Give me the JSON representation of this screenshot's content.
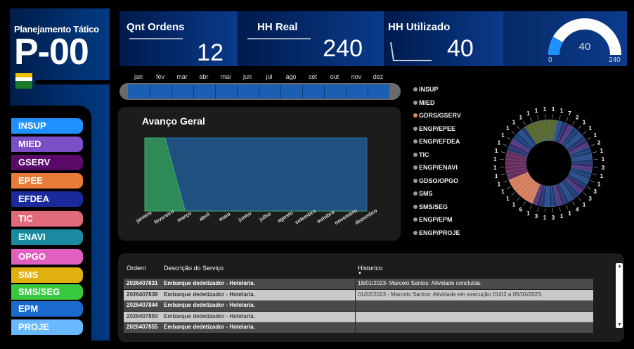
{
  "header": {
    "app_title": "Planejamento Tático",
    "page_code": "P-00"
  },
  "nav": {
    "items": [
      {
        "label": "INSUP",
        "color": "#1e90ff"
      },
      {
        "label": "MIED",
        "color": "#7b4fc8"
      },
      {
        "label": "GSERV",
        "color": "#5b0a6a"
      },
      {
        "label": "EPEE",
        "color": "#e87a3a"
      },
      {
        "label": "EFDEA",
        "color": "#1a2a9a"
      },
      {
        "label": "TIC",
        "color": "#e06a78"
      },
      {
        "label": "ENAVI",
        "color": "#1a8aa0"
      },
      {
        "label": "OPGO",
        "color": "#e060c0"
      },
      {
        "label": "SMS",
        "color": "#e0b010"
      },
      {
        "label": "SMS/SEG",
        "color": "#38c840"
      },
      {
        "label": "EPM",
        "color": "#1a6ad0"
      },
      {
        "label": "PROJE",
        "color": "#6ab8ff"
      }
    ]
  },
  "kpis": {
    "orders": {
      "title": "Qnt Ordens",
      "value": "12"
    },
    "hh_real": {
      "title": "HH Real",
      "value": "240"
    },
    "hh_used": {
      "title": "HH Utilizado",
      "value": "40"
    }
  },
  "gauge": {
    "value": "40",
    "min": "0",
    "max": "240",
    "fraction": 0.1667
  },
  "months": [
    "jan",
    "fev",
    "mar",
    "abr",
    "mai",
    "jun",
    "jul",
    "ago",
    "set",
    "out",
    "nov",
    "dez"
  ],
  "chart_data": {
    "type": "area",
    "title": "Avanço Geral",
    "categories": [
      "janeiro",
      "fevereiro",
      "março",
      "abril",
      "maio",
      "junho",
      "julho",
      "agosto",
      "setembro",
      "outubro",
      "novembro",
      "dezembro"
    ],
    "series": [
      {
        "color": "#2e8b57",
        "values": [
          1,
          1,
          0,
          0,
          0,
          0,
          0,
          0,
          0,
          0,
          0,
          0
        ]
      },
      {
        "color": "#1f5080",
        "values": [
          1,
          1,
          1,
          1,
          1,
          1,
          1,
          1,
          1,
          1,
          1,
          1
        ]
      }
    ],
    "ylim": [
      0,
      1
    ]
  },
  "legend": {
    "items": [
      {
        "label": "INSUP",
        "color": "#999999"
      },
      {
        "label": "MIED",
        "color": "#999999"
      },
      {
        "label": "GDRS/GSERV",
        "color": "#e8845a"
      },
      {
        "label": "ENGP/EPEE",
        "color": "#999999"
      },
      {
        "label": "ENGP/EFDEA",
        "color": "#999999"
      },
      {
        "label": "TIC",
        "color": "#999999"
      },
      {
        "label": "ENGP/ENAVI",
        "color": "#999999"
      },
      {
        "label": "GDSO/OPGO",
        "color": "#999999"
      },
      {
        "label": "SMS",
        "color": "#999999"
      },
      {
        "label": "SMS/SEG",
        "color": "#999999"
      },
      {
        "label": "ENGP/EPM",
        "color": "#999999"
      },
      {
        "label": "ENGP/PROJE",
        "color": "#999999"
      }
    ]
  },
  "donut": {
    "labels": [
      "1",
      "1",
      "7",
      "2",
      "1",
      "1",
      "1",
      "2",
      "1",
      "1",
      "3",
      "1",
      "1",
      "3",
      "3",
      "1",
      "4",
      "1",
      "1",
      "3",
      "1",
      "3",
      "1",
      "6",
      "1",
      "1",
      "1",
      "1",
      "1",
      "1",
      "1",
      "1",
      "1",
      "1",
      "1",
      "1",
      "1",
      "1",
      "1",
      "1"
    ]
  },
  "table": {
    "headers": {
      "ordem": "Ordem",
      "descricao": "Descrição do Serviço",
      "historico": "Historico"
    },
    "rows": [
      {
        "ordem": "2026407831",
        "descricao": "Embarque dedetizador - Hotelaria.",
        "historico": "18/01/2023- Marcelo Santos: Atividade concluída."
      },
      {
        "ordem": "2026407838",
        "descricao": "Embarque dedetizador - Hotelaria.",
        "historico": "01/02/2023 - Marcelo Santos: Atividade em execução 01/02 a 05/02/2023."
      },
      {
        "ordem": "2026407844",
        "descricao": "Embarque dedetizador - Hotelaria.",
        "historico": ""
      },
      {
        "ordem": "2026407850",
        "descricao": "Embarque dedetizador - Hotelaria.",
        "historico": ""
      },
      {
        "ordem": "2026407855",
        "descricao": "Embarque dedetizador - Hotelaria.",
        "historico": ""
      }
    ]
  }
}
